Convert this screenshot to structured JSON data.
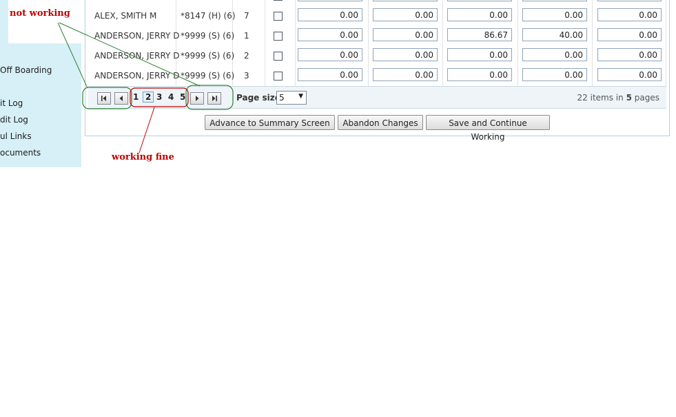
{
  "sidebar": {
    "items": [
      {
        "label": "Off Boarding"
      },
      {
        "label": "it Log"
      },
      {
        "label": "dit Log"
      },
      {
        "label": "ul Links"
      },
      {
        "label": "ocuments"
      }
    ]
  },
  "annotations": {
    "not_working": "not working",
    "working_fine": "working fine"
  },
  "grid": {
    "rows": [
      {
        "name": "ALEX, SMITH M",
        "code": "*8147 (H) (6)",
        "seq": "7",
        "values": [
          "0.00",
          "0.00",
          "0.00",
          "0.00",
          "0.00"
        ]
      },
      {
        "name": "ANDERSON, JERRY D",
        "code": "*9999 (S) (6)",
        "seq": "1",
        "values": [
          "0.00",
          "0.00",
          "86.67",
          "40.00",
          "0.00"
        ]
      },
      {
        "name": "ANDERSON, JERRY D",
        "code": "*9999 (S) (6)",
        "seq": "2",
        "values": [
          "0.00",
          "0.00",
          "0.00",
          "0.00",
          "0.00"
        ]
      },
      {
        "name": "ANDERSON, JERRY D",
        "code": "*9999 (S) (6)",
        "seq": "3",
        "values": [
          "0.00",
          "0.00",
          "0.00",
          "0.00",
          "0.00"
        ]
      }
    ]
  },
  "pager": {
    "pages": [
      "1",
      "2",
      "3",
      "4",
      "5"
    ],
    "current_page": "2",
    "page_size_label": "Page size:",
    "page_size_value": "5",
    "info_count": "22",
    "info_mid": "items in",
    "info_pages": "5",
    "info_suffix": "pages",
    "icons": {
      "first": "first-page-icon",
      "prev": "prev-page-icon",
      "next": "next-page-icon",
      "last": "last-page-icon"
    }
  },
  "actions": {
    "advance": "Advance to Summary Screen",
    "abandon": "Abandon Changes",
    "save": "Save and Continue Working"
  },
  "colors": {
    "sidebar_bg": "#d7f0f7",
    "annotation_red": "#c00000",
    "annotation_green": "#2e7d32"
  }
}
